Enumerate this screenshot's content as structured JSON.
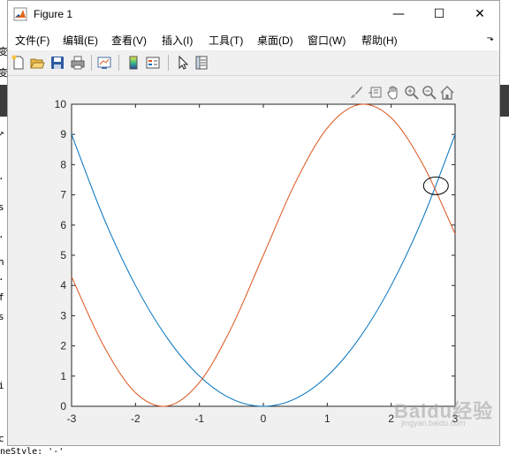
{
  "window": {
    "title": "Figure 1",
    "minimize_glyph": "—",
    "maximize_glyph": "☐",
    "close_glyph": "✕"
  },
  "menu": {
    "items": [
      "文件(F)",
      "编辑(E)",
      "查看(V)",
      "插入(I)",
      "工具(T)",
      "桌面(D)",
      "窗口(W)",
      "帮助(H)"
    ],
    "overflow_glyph": "⬎"
  },
  "toolbar": {
    "icons": [
      "new-figure-icon",
      "open-file-icon",
      "save-icon",
      "print-icon",
      "link-plot-icon",
      "colorbar-icon",
      "legend-icon",
      "edit-plot-arrow-icon",
      "property-inspector-icon"
    ]
  },
  "axes_toolbar": {
    "icons": [
      "brush-icon",
      "data-tips-icon",
      "pan-hand-icon",
      "zoom-in-icon",
      "zoom-out-icon",
      "restore-view-home-icon"
    ]
  },
  "background": {
    "left_fragments": [
      "变",
      "变",
      "工",
      "↗",
      "·",
      "s",
      "·",
      "n",
      "·",
      "f",
      "s",
      "i",
      "c"
    ],
    "bottom_fragment": "neStyle: '-'"
  },
  "watermark": {
    "text": "Baidu经验",
    "sub": "jingyan.baidu.com"
  },
  "chart_data": {
    "type": "line",
    "title": "",
    "xlabel": "",
    "ylabel": "",
    "xlim": [
      -3,
      3
    ],
    "ylim": [
      0,
      10
    ],
    "xticks": [
      -3,
      -2,
      -1,
      0,
      1,
      2,
      3
    ],
    "yticks": [
      0,
      1,
      2,
      3,
      4,
      5,
      6,
      7,
      8,
      9,
      10
    ],
    "grid": false,
    "legend": "none",
    "x": [
      -3,
      -2.5,
      -2,
      -1.5,
      -1,
      -0.5,
      0,
      0.5,
      1,
      1.5,
      2,
      2.5,
      3
    ],
    "series": [
      {
        "color": "#0072BD",
        "values": [
          9,
          6.25,
          4,
          2.25,
          1,
          0.25,
          0,
          0.25,
          1,
          2.25,
          4,
          6.25,
          9
        ]
      },
      {
        "color": "#D95319",
        "values": [
          4.29,
          2.01,
          0.45,
          0.01,
          0.79,
          2.6,
          5,
          7.4,
          9.21,
          9.99,
          9.55,
          7.99,
          5.71
        ]
      }
    ],
    "annotation": {
      "shape": "ellipse",
      "center": [
        2.7,
        7.3
      ],
      "color": "#000000"
    }
  }
}
